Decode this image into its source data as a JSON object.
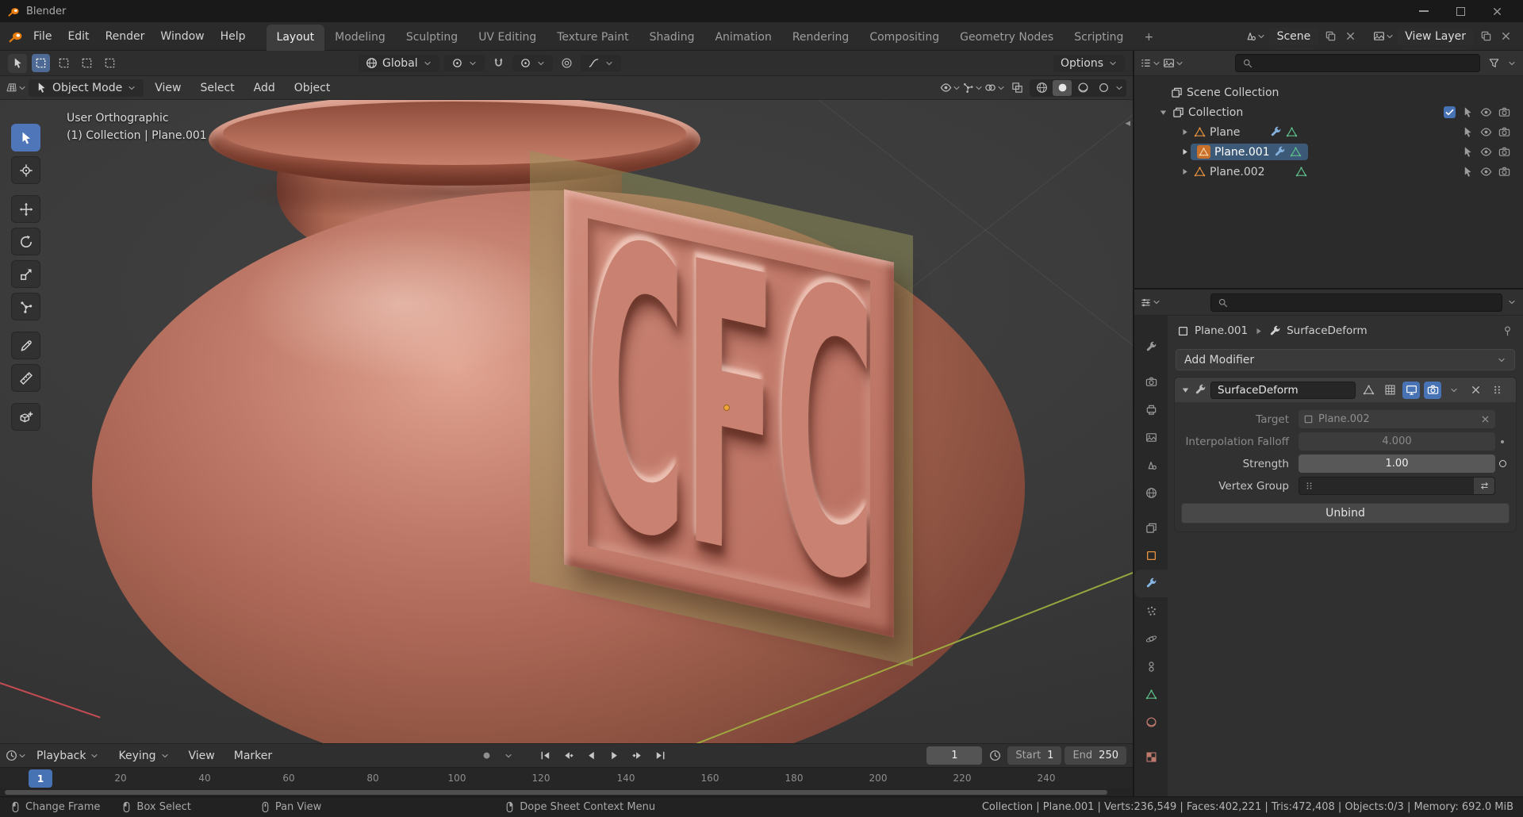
{
  "titlebar": {
    "app_title": "Blender"
  },
  "menubar": {
    "menus": [
      "File",
      "Edit",
      "Render",
      "Window",
      "Help"
    ],
    "tabs": [
      "Layout",
      "Modeling",
      "Sculpting",
      "UV Editing",
      "Texture Paint",
      "Shading",
      "Animation",
      "Rendering",
      "Compositing",
      "Geometry Nodes",
      "Scripting"
    ],
    "active_tab": "Layout",
    "add_tab": "+",
    "scene_label": "Scene",
    "view_layer_label": "View Layer"
  },
  "tool_settings": {
    "orientation_label": "Global",
    "options_label": "Options"
  },
  "viewport": {
    "mode_label": "Object Mode",
    "menus": [
      "View",
      "Select",
      "Add",
      "Object"
    ],
    "overlay_line1": "User Orthographic",
    "overlay_line2": "(1) Collection | Plane.001",
    "plaque_text": "CFC"
  },
  "outliner": {
    "rows": [
      {
        "name": "Scene Collection"
      },
      {
        "name": "Collection"
      },
      {
        "name": "Plane"
      },
      {
        "name": "Plane.001"
      },
      {
        "name": "Plane.002"
      }
    ]
  },
  "properties": {
    "breadcrumb_object": "Plane.001",
    "breadcrumb_modifier": "SurfaceDeform",
    "add_modifier_label": "Add Modifier",
    "modifier_name": "SurfaceDeform",
    "target_label": "Target",
    "target_value": "Plane.002",
    "falloff_label": "Interpolation Falloff",
    "falloff_value": "4.000",
    "strength_label": "Strength",
    "strength_value": "1.00",
    "vertex_group_label": "Vertex Group",
    "unbind_label": "Unbind"
  },
  "timeline": {
    "menus": [
      "Playback",
      "Keying",
      "View",
      "Marker"
    ],
    "frame_field": "1",
    "start_label": "Start",
    "start_value": "1",
    "end_label": "End",
    "end_value": "250",
    "current_frame": "1",
    "ruler": [
      "20",
      "40",
      "60",
      "80",
      "100",
      "120",
      "140",
      "160",
      "180",
      "200",
      "220",
      "240"
    ]
  },
  "statusbar": {
    "hints": [
      "Change Frame",
      "Box Select",
      "Pan View",
      "Dope Sheet Context Menu"
    ],
    "stats": "Collection | Plane.001 | Verts:236,549 | Faces:402,221 | Tris:472,408 | Objects:0/3 | Memory: 692.0 MiB"
  },
  "colors": {
    "accent_blue": "#4772b3",
    "blender_orange": "#e87d0d",
    "pot_terracotta": "#b06a5a",
    "selection_row": "#3c5a77",
    "green_plane": "#98985c"
  }
}
